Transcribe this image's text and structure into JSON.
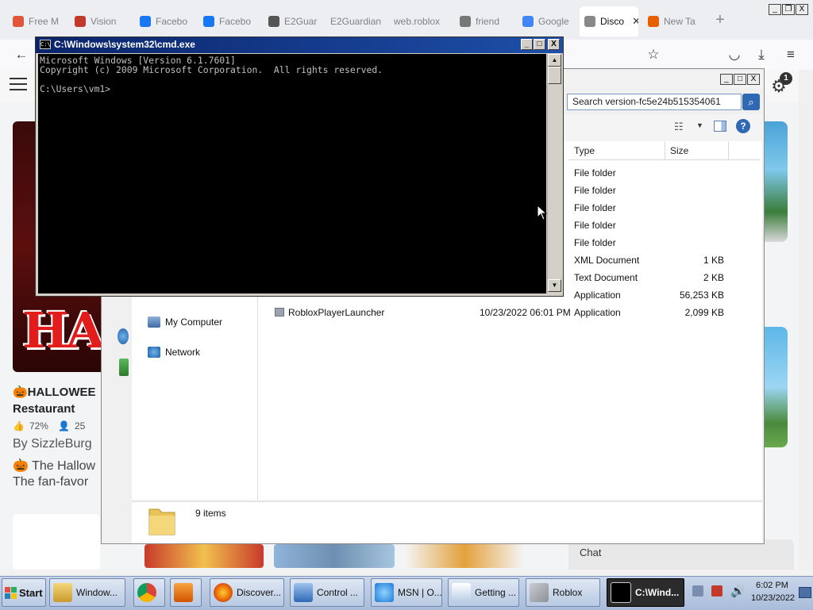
{
  "browser": {
    "tabs": [
      {
        "label": "Free M",
        "icon": "firefox-relay-icon",
        "color": "#e0563b"
      },
      {
        "label": "Vision",
        "icon": "roblox-icon",
        "color": "#c0392b"
      },
      {
        "label": "Facebo",
        "icon": "facebook-icon",
        "color": "#1877f2"
      },
      {
        "label": "Facebo",
        "icon": "facebook-dot-icon",
        "color": "#1877f2"
      },
      {
        "label": "E2Guar",
        "icon": "building-icon",
        "color": "#555555"
      },
      {
        "label": "E2Guardian",
        "icon": "none",
        "color": "#888888"
      },
      {
        "label": "web.roblox",
        "icon": "none",
        "color": "#888888"
      },
      {
        "label": "friend",
        "icon": "roblox-icon",
        "color": "#777777"
      },
      {
        "label": "Google",
        "icon": "google-icon",
        "color": "#4285f4"
      },
      {
        "label": "Disco",
        "icon": "roblox-icon",
        "color": "#888888",
        "active": true
      },
      {
        "label": "New Ta",
        "icon": "firefox-icon",
        "color": "#e66000"
      }
    ],
    "new_tab": "+",
    "window_controls": {
      "minimize": "_",
      "restore": "❐",
      "close": "X"
    },
    "nav": {
      "back": "←",
      "bookmark": "☆",
      "pocket": "◡",
      "download": "⤓",
      "menu": "≡"
    }
  },
  "roblox": {
    "notification_count": "1",
    "game": {
      "title_line1": "🎃HALLOWEE",
      "title_line2": "Restaurant",
      "rating": "72%",
      "players": "25",
      "by": "By SizzleBurg",
      "desc_line1": "🎃 The Hallow",
      "desc_line2": "The fan-favor",
      "thumb_text": "HA"
    },
    "chat_label": "Chat"
  },
  "explorer": {
    "search_placeholder": "Search version-fc5e24b515354061",
    "columns": {
      "type": "Type",
      "size": "Size"
    },
    "rows": [
      {
        "name": "",
        "date": "",
        "type": "File folder",
        "size": ""
      },
      {
        "name": "",
        "date": "",
        "type": "File folder",
        "size": ""
      },
      {
        "name": "",
        "date": "",
        "type": "File folder",
        "size": ""
      },
      {
        "name": "",
        "date": "",
        "type": "File folder",
        "size": ""
      },
      {
        "name": "",
        "date": "",
        "type": "File folder",
        "size": ""
      },
      {
        "name": "",
        "date": "",
        "type": "XML Document",
        "size": "1 KB"
      },
      {
        "name": "",
        "date": "",
        "type": "Text Document",
        "size": "2 KB"
      },
      {
        "name": "",
        "date": "",
        "type": "Application",
        "size": "56,253 KB"
      },
      {
        "name": "RobloxPlayerLauncher",
        "date": "10/23/2022 06:01 PM",
        "type": "Application",
        "size": "2,099 KB"
      }
    ],
    "nav": {
      "my_computer": "My Computer",
      "network": "Network"
    },
    "status": "9 items",
    "window_controls": {
      "minimize": "_",
      "maximize": "□",
      "close": "X"
    }
  },
  "cmd": {
    "title": "C:\\Windows\\system32\\cmd.exe",
    "lines": [
      "Microsoft Windows [Version 6.1.7601]",
      "Copyright (c) 2009 Microsoft Corporation.  All rights reserved.",
      "",
      "C:\\Users\\vm1>"
    ],
    "controls": {
      "minimize": "_",
      "maximize": "□",
      "close": "X"
    }
  },
  "taskbar": {
    "start": "Start",
    "buttons": [
      {
        "label": "Window...",
        "icon": "explorer-icon"
      },
      {
        "label": "",
        "icon": "chrome-icon"
      },
      {
        "label": "",
        "icon": "media-player-icon"
      },
      {
        "label": "Discover...",
        "icon": "firefox-icon"
      },
      {
        "label": "Control ...",
        "icon": "control-panel-icon"
      },
      {
        "label": "MSN | O...",
        "icon": "ie-icon"
      },
      {
        "label": "Getting ...",
        "icon": "document-icon"
      },
      {
        "label": "Roblox",
        "icon": "roblox-icon"
      },
      {
        "label": "C:\\Wind...",
        "icon": "cmd-icon",
        "active": true
      }
    ],
    "clock_time": "6:02 PM",
    "clock_date": "10/23/2022"
  }
}
